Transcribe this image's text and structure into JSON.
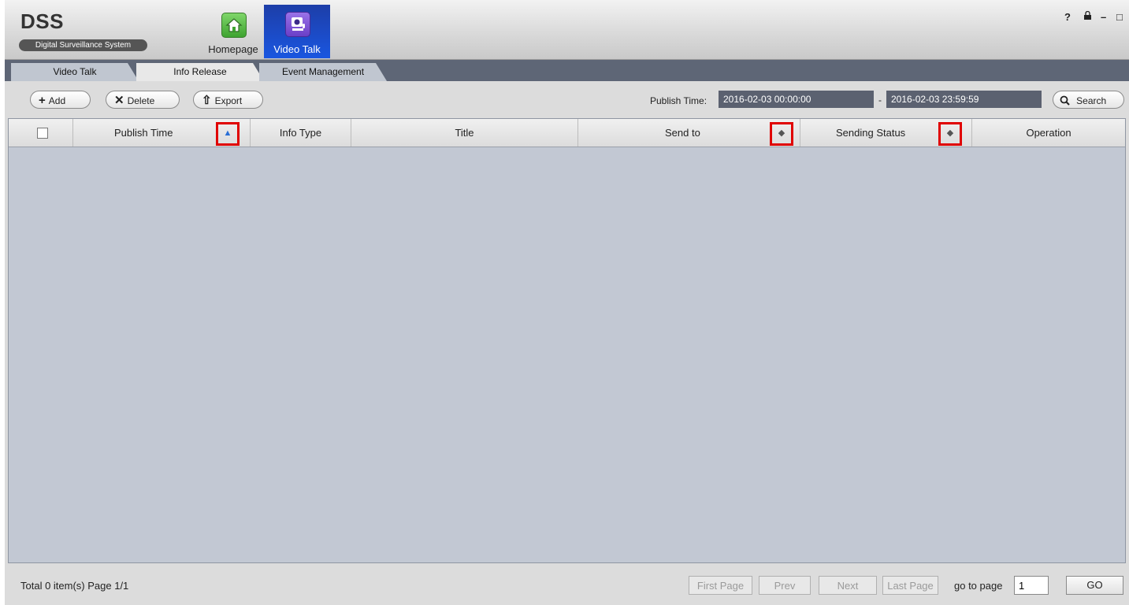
{
  "app": {
    "logo": "DSS",
    "logo_subtitle": "Digital Surveillance System",
    "modules": [
      {
        "label": "Homepage",
        "icon": "home-icon"
      },
      {
        "label": "Video Talk",
        "icon": "video-talk-icon"
      }
    ],
    "window_controls": {
      "help": "?",
      "lock": "🔒",
      "minimize": "–",
      "maximize": "□",
      "close": "×"
    }
  },
  "tabs": [
    {
      "label": "Video Talk",
      "active": false
    },
    {
      "label": "Info Release",
      "active": true
    },
    {
      "label": "Event Management",
      "active": false
    }
  ],
  "toolbar": {
    "add_label": "Add",
    "delete_label": "Delete",
    "export_label": "Export",
    "publish_time_label": "Publish Time:",
    "start_time": "2016-02-03 00:00:00",
    "separator": "-",
    "end_time": "2016-02-03 23:59:59",
    "search_label": "Search"
  },
  "table": {
    "columns": [
      "Publish Time",
      "Info Type",
      "Title",
      "Send to",
      "Sending Status",
      "Operation"
    ],
    "rows": []
  },
  "footer": {
    "summary": "Total 0 item(s)  Page 1/1",
    "first_page": "First Page",
    "prev": "Prev",
    "next": "Next",
    "last_page": "Last Page",
    "go_to_page_label": "go to page",
    "page_value": "1",
    "go_label": "GO"
  },
  "colors": {
    "active_module": "#1a56e0",
    "tabbar": "#5e6676",
    "table_body": "#c2c8d3",
    "highlight_box": "#e00000"
  }
}
